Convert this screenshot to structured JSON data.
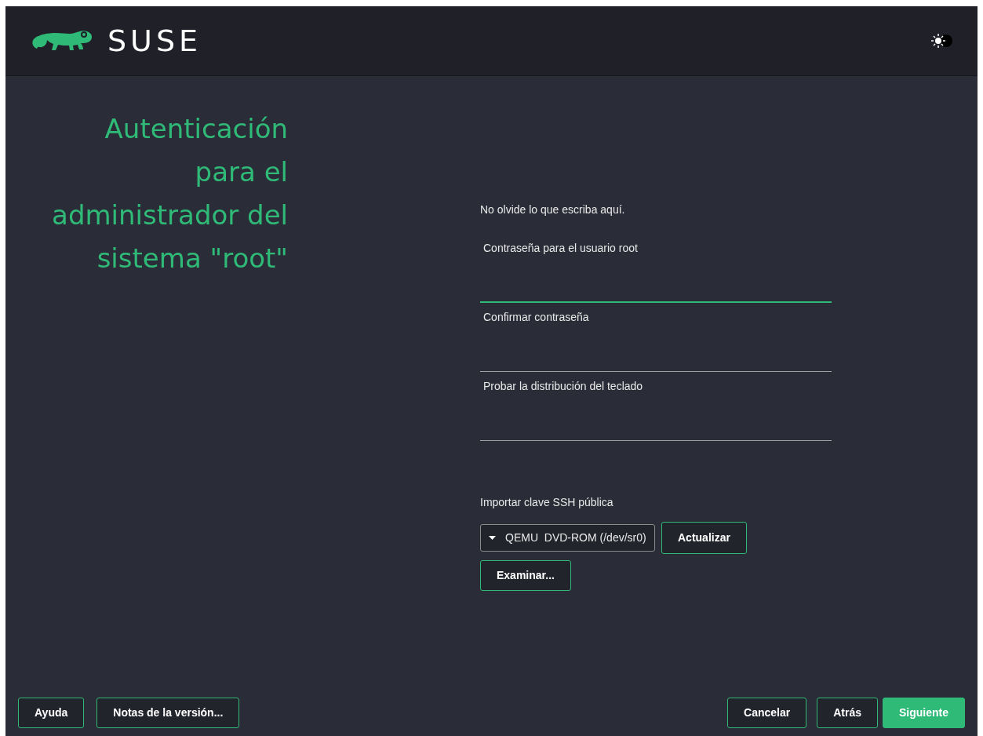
{
  "header": {
    "brand": "SUSE"
  },
  "title_lines": [
    "Autenticación",
    "para el",
    "administrador del",
    "sistema \"root\""
  ],
  "note": "No olvide lo que escriba aquí.",
  "fields": [
    {
      "label": "Contraseña para el usuario root",
      "focused": true
    },
    {
      "label": "Confirmar contraseña",
      "focused": false
    },
    {
      "label": "Probar la distribución del teclado",
      "focused": false
    }
  ],
  "ssh": {
    "label": "Importar clave SSH pública",
    "device": "QEMU  DVD-ROM (/dev/sr0)",
    "refresh": "Actualizar",
    "browse": "Examinar..."
  },
  "footer": {
    "left": [
      "Ayuda",
      "Notas de la versión..."
    ],
    "right": [
      {
        "label": "Cancelar",
        "primary": false
      },
      {
        "label": "Atrás",
        "primary": false
      },
      {
        "label": "Siguiente",
        "primary": true
      }
    ]
  }
}
